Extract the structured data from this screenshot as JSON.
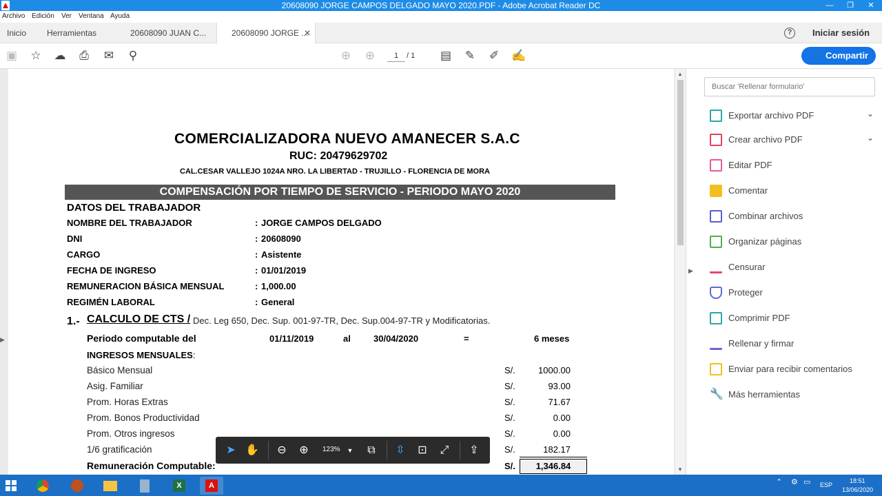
{
  "window": {
    "title": "20608090  JORGE CAMPOS DELGADO MAYO 2020.PDF - Adobe Acrobat Reader DC"
  },
  "menu": [
    "Archivo",
    "Edición",
    "Ver",
    "Ventana",
    "Ayuda"
  ],
  "tabs": {
    "home": "Inicio",
    "tools": "Herramientas",
    "doc1": "20608090  JUAN C...",
    "doc2": "20608090  JORGE ..."
  },
  "header": {
    "signin": "Iniciar sesión",
    "share": "Compartir"
  },
  "nav": {
    "page": "1",
    "total": "/  1"
  },
  "rightpanel": {
    "search_placeholder": "Buscar 'Rellenar formulario'",
    "tools": [
      {
        "label": "Exportar archivo PDF",
        "color": "#2aa6a6"
      },
      {
        "label": "Crear archivo PDF",
        "color": "#e0455b"
      },
      {
        "label": "Editar PDF",
        "color": "#e35c9a"
      },
      {
        "label": "Comentar",
        "color": "#f2c01e"
      },
      {
        "label": "Combinar archivos",
        "color": "#5b5bd6"
      },
      {
        "label": "Organizar páginas",
        "color": "#4caf50"
      },
      {
        "label": "Censurar",
        "color": "#e0457b"
      },
      {
        "label": "Proteger",
        "color": "#5b6bd6"
      },
      {
        "label": "Comprimir PDF",
        "color": "#2aa6a6"
      },
      {
        "label": "Rellenar y firmar",
        "color": "#7a5bd6"
      },
      {
        "label": "Enviar para recibir comentarios",
        "color": "#f2c01e"
      },
      {
        "label": "Más herramientas",
        "color": "#555555"
      }
    ]
  },
  "doc": {
    "company": "COMERCIALIZADORA NUEVO AMANECER S.A.C",
    "ruc": "RUC: 20479629702",
    "address": "CAL.CESAR VALLEJO 1024A NRO. LA LIBERTAD - TRUJILLO - FLORENCIA DE MORA",
    "banner": "COMPENSACIÓN POR TIEMPO DE SERVICIO - PERIODO MAYO 2020",
    "section": "DATOS DEL TRABAJADOR",
    "fields": [
      {
        "k": "NOMBRE DEL TRABAJADOR",
        "v": "JORGE CAMPOS DELGADO"
      },
      {
        "k": "DNI",
        "v": "20608090"
      },
      {
        "k": "CARGO",
        "v": "Asistente"
      },
      {
        "k": "FECHA DE INGRESO",
        "v": "01/01/2019"
      },
      {
        "k": "REMUNERACION BÁSICA MENSUAL",
        "v": "1,000.00"
      },
      {
        "k": "REGIMÉN LABORAL",
        "v": "General"
      }
    ],
    "calc_num": "1.-",
    "calc_title": "CALCULO DE CTS /",
    "calc_sub": "Dec. Leg 650, Dec. Sup. 001-97-TR, Dec. Sup.004-97-TR y Modificatorias.",
    "period_label": "Periodo computable del",
    "period_from": "01/11/2019",
    "period_al": "al",
    "period_to": "30/04/2020",
    "period_eq": "=",
    "period_months": "6 meses",
    "ingresos": "INGRESOS MENSUALES",
    "rows": [
      {
        "k": "Básico Mensual",
        "v": "1000.00"
      },
      {
        "k": "Asig. Familiar",
        "v": "93.00"
      },
      {
        "k": "Prom. Horas Extras",
        "v": "71.67"
      },
      {
        "k": "Prom. Bonos Productividad",
        "v": "0.00"
      },
      {
        "k": "Prom. Otros ingresos",
        "v": "0.00"
      },
      {
        "k": "1/6 gratificación",
        "v": "182.17"
      }
    ],
    "currency": "S/.",
    "total_label": "Remuneración Computable:",
    "total_value": "1,346.84"
  },
  "floatbar": {
    "zoom": "123%"
  },
  "taskbar": {
    "lang": "ESP",
    "time": "18:51",
    "date": "13/06/2020"
  }
}
